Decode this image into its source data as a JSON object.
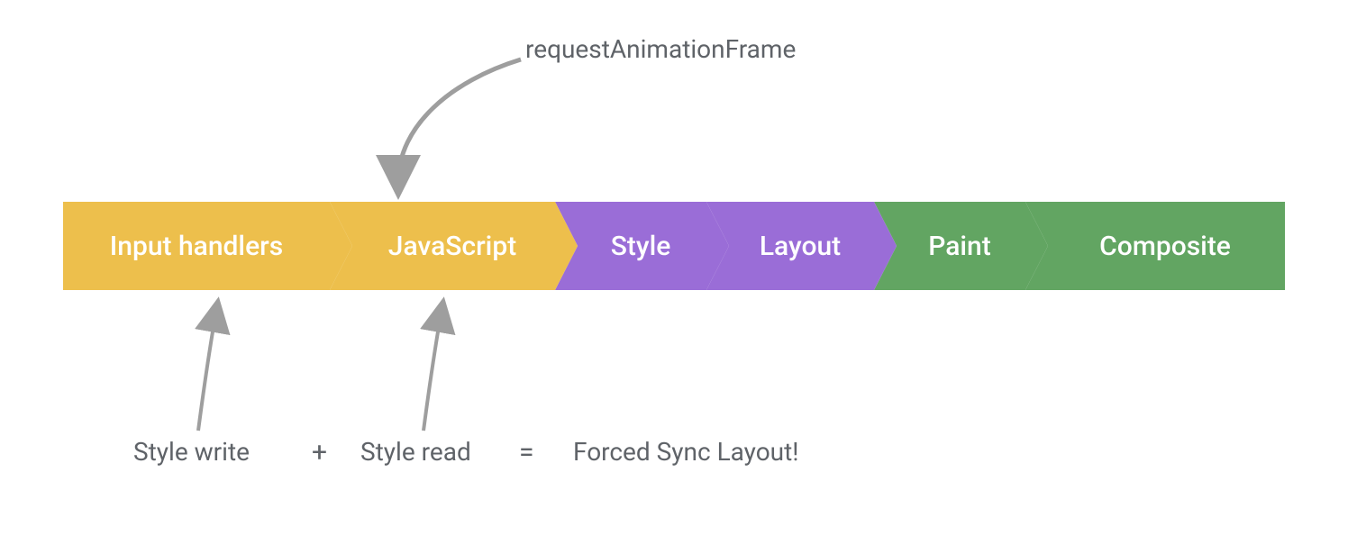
{
  "top_label": "requestAnimationFrame",
  "pipeline": {
    "steps": [
      {
        "label": "Input handlers",
        "color": "yellow"
      },
      {
        "label": "JavaScript",
        "color": "yellow"
      },
      {
        "label": "Style",
        "color": "purple"
      },
      {
        "label": "Layout",
        "color": "purple"
      },
      {
        "label": "Paint",
        "color": "green"
      },
      {
        "label": "Composite",
        "color": "green"
      }
    ]
  },
  "bottom_equation": {
    "term1": "Style write",
    "op1": "+",
    "term2": "Style read",
    "op2": "=",
    "result": "Forced Sync Layout!"
  },
  "colors": {
    "yellow": "#edbf4c",
    "purple": "#9a6dd7",
    "green": "#62a562",
    "arrow": "#9e9e9e",
    "text": "#5f6368"
  }
}
